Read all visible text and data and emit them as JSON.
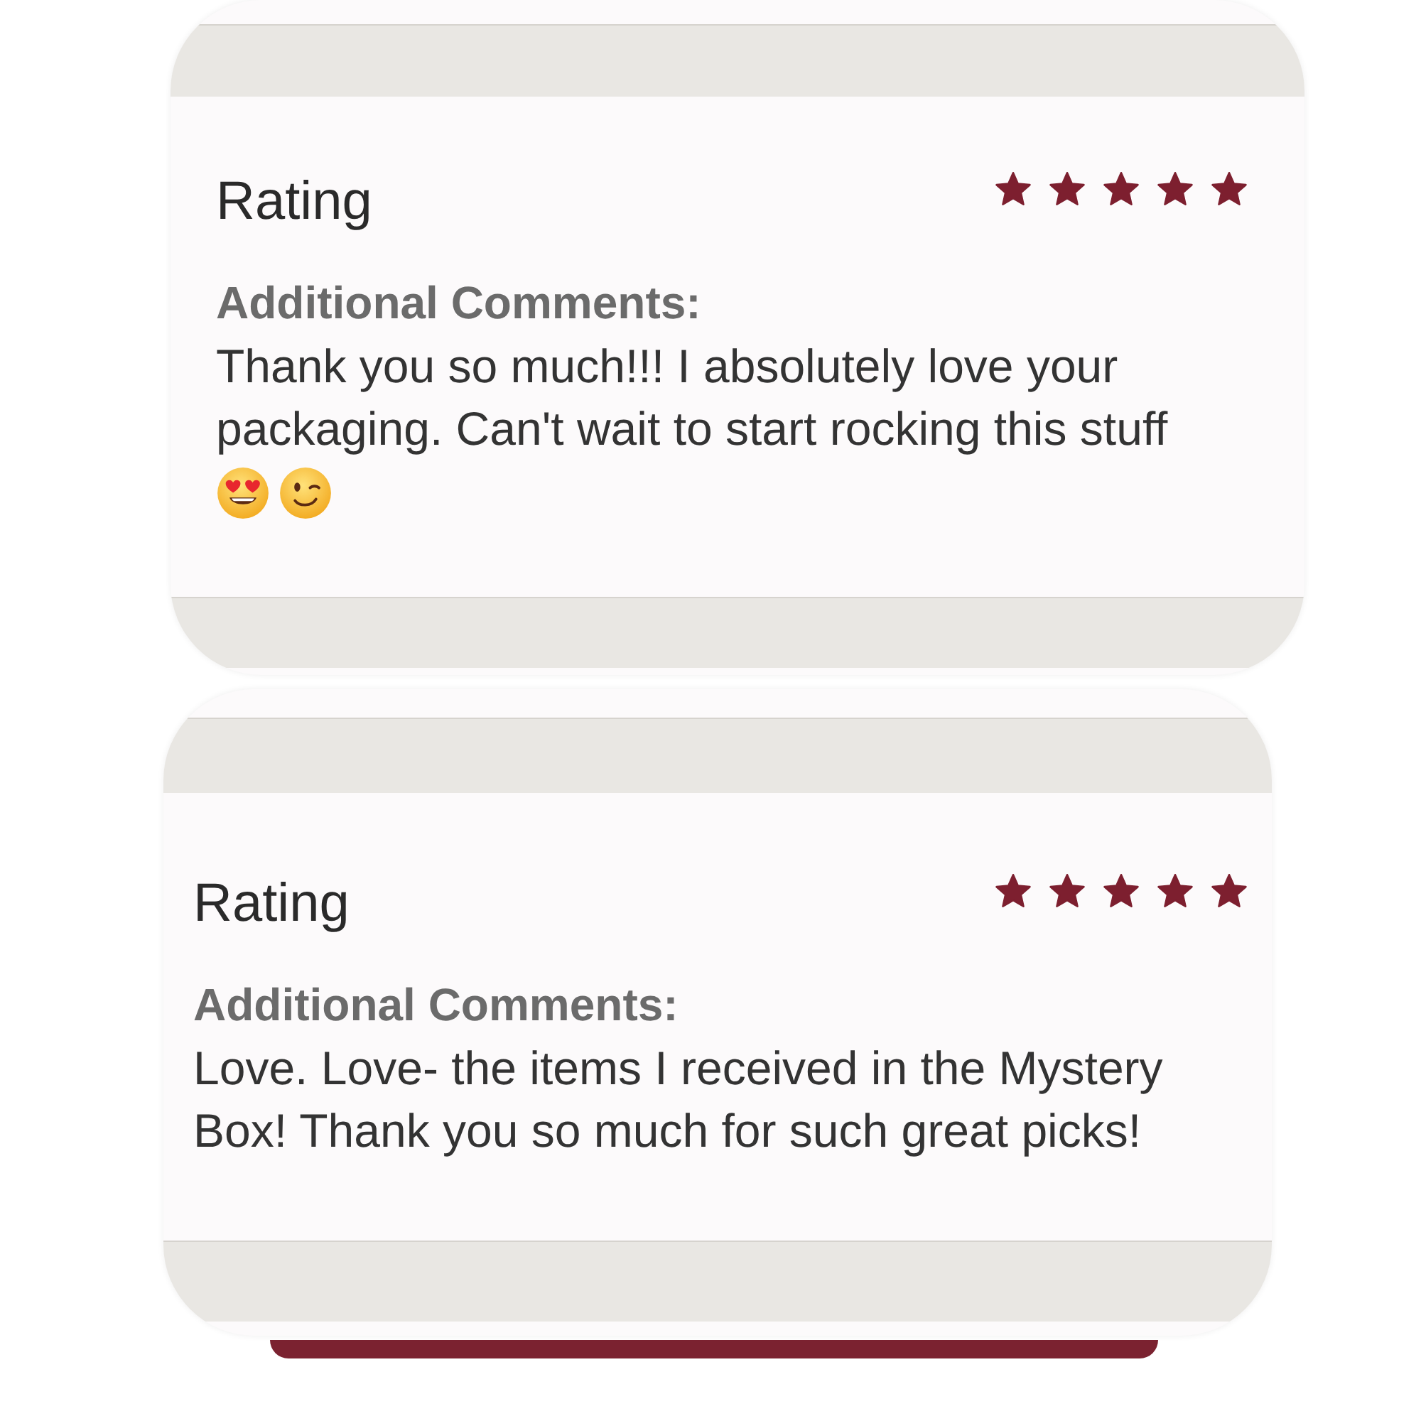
{
  "reviews": [
    {
      "heading": "Rating",
      "stars": 5,
      "comments_label": "Additional Comments:",
      "comment": "Thank you so much!!! I absolutely love your packaging. Can't wait to start rocking this stuff",
      "emoji": [
        {
          "kind": "heart_eyes"
        },
        {
          "kind": "wink"
        }
      ]
    },
    {
      "heading": "Rating",
      "stars": 5,
      "comments_label": "Additional Comments:",
      "comment": "Love. Love- the items I received in the Mystery Box! Thank you so much for such great picks!"
    }
  ]
}
